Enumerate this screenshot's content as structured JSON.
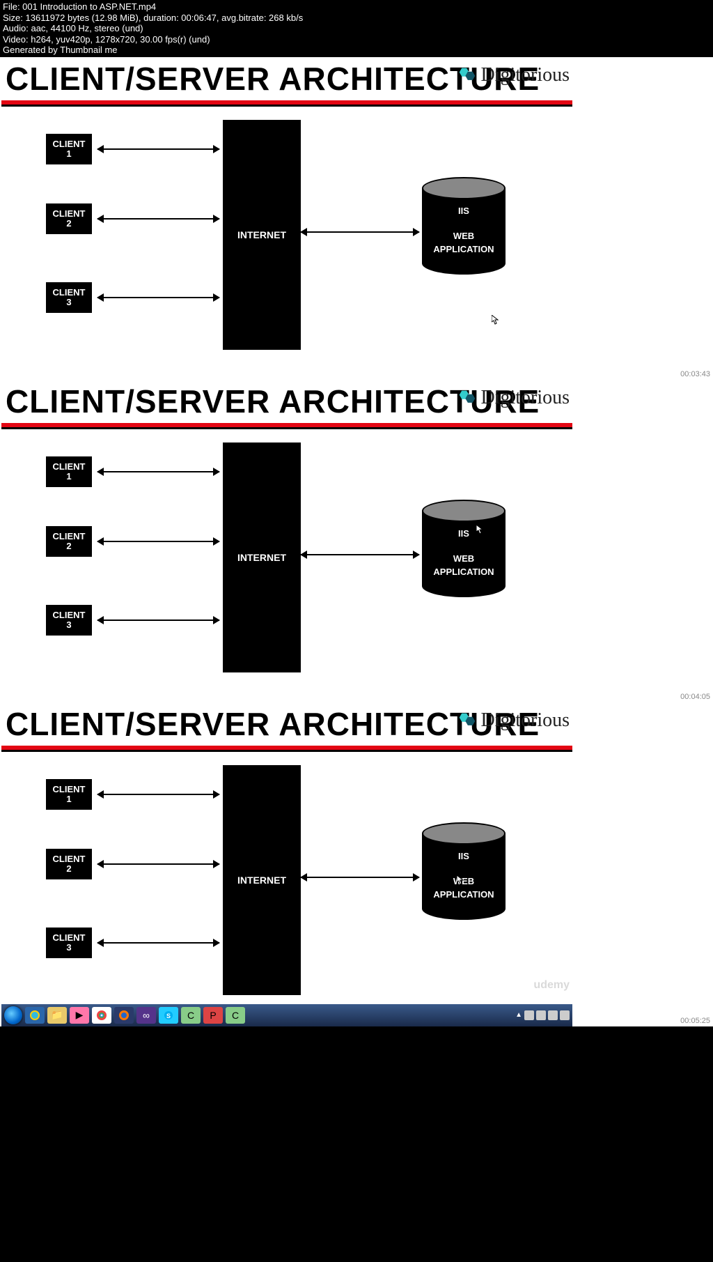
{
  "meta": {
    "file": "File: 001 Introduction to ASP.NET.mp4",
    "size": "Size: 13611972 bytes (12.98 MiB), duration: 00:06:47, avg.bitrate: 268 kb/s",
    "audio": "Audio: aac, 44100 Hz, stereo (und)",
    "video": "Video: h264, yuv420p, 1278x720, 30.00 fps(r) (und)",
    "gen": "Generated by Thumbnail me"
  },
  "slide": {
    "title": "CLIENT/SERVER ARCHITECTURE",
    "brand": "Digitorious",
    "client1a": "CLIENT",
    "client1b": "1",
    "client2a": "CLIENT",
    "client2b": "2",
    "client3a": "CLIENT",
    "client3b": "3",
    "internet": "INTERNET",
    "cyl1": "IIS",
    "cyl2": "WEB",
    "cyl3": "APPLICATION"
  },
  "timestamps": {
    "t1": "00:03:43",
    "t2": "00:04:05",
    "t3": "00:05:25"
  },
  "watermark": "udemy",
  "taskbar_tray_text": ""
}
